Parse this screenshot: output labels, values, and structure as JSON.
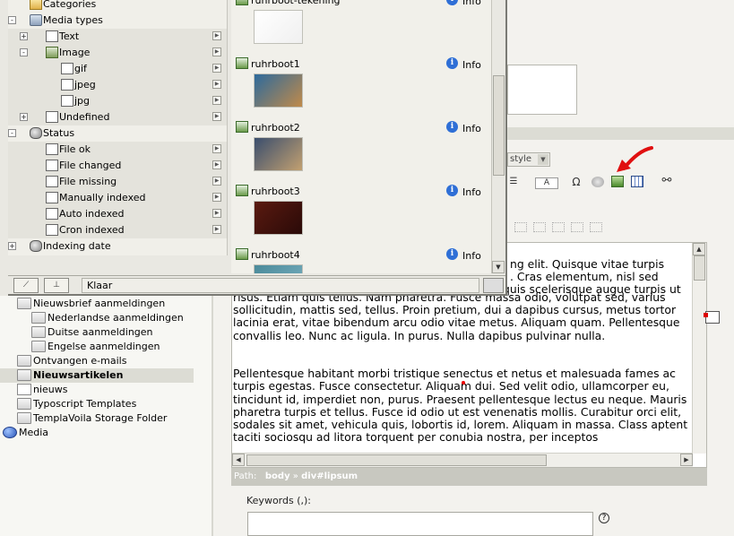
{
  "background_tree": {
    "items": [
      {
        "label": "Nieuwsbrief aanmeldingen",
        "indent": 0,
        "icon": "folder-icon"
      },
      {
        "label": "Nederlandse aanmeldingen",
        "indent": 1,
        "icon": "folder-icon"
      },
      {
        "label": "Duitse aanmeldingen",
        "indent": 1,
        "icon": "folder-icon"
      },
      {
        "label": "Engelse aanmeldingen",
        "indent": 1,
        "icon": "folder-icon"
      },
      {
        "label": "Ontvangen e-mails",
        "indent": 0,
        "icon": "folder-icon"
      },
      {
        "label": "Nieuwsartikelen",
        "indent": 0,
        "icon": "folder-icon",
        "selected": true
      },
      {
        "label": "nieuws",
        "indent": 0,
        "icon": "page-icon"
      },
      {
        "label": "Typoscript Templates",
        "indent": 0,
        "icon": "folder-icon"
      },
      {
        "label": "TemplaVoila Storage Folder",
        "indent": 0,
        "icon": "folder-icon"
      },
      {
        "label": "Media",
        "indent": -1,
        "icon": "globe-icon"
      }
    ]
  },
  "editor": {
    "style_select": "style",
    "text_partial_lines": [
      "ng elit. Quisque vitae turpis",
      ". Cras elementum, nisl sed",
      "quis scelerisque augue turpis ut"
    ],
    "paragraphs": [
      "risus. Etiam quis tellus. Nam pharetra. Fusce massa odio, volutpat sed, varius sollicitudin, mattis sed, tellus. Proin pretium, dui a dapibus cursus, metus tortor lacinia erat, vitae bibendum arcu odio vitae metus. Aliquam quam. Pellentesque convallis leo. Nunc ac ligula. In purus. Nulla dapibus pulvinar nulla.",
      "Pellentesque habitant morbi tristique senectus et netus et malesuada fames ac turpis egestas. Fusce consectetur. Aliquam dui. Sed velit odio, ullamcorper eu, tincidunt id, imperdiet non, purus. Praesent pellentesque lectus eu neque. Mauris pharetra turpis et tellus. Fusce id odio ut est venenatis mollis. Curabitur orci elit, sodales sit amet, vehicula quis, lobortis id, lorem. Aliquam in massa. Class aptent taciti sociosqu ad litora torquent per conubia nostra, per inceptos"
    ],
    "path_label": "Path:",
    "path_body": "body",
    "path_sep": "»",
    "path_div": "div#lipsum",
    "keywords_label": "Keywords (,):",
    "help": "?"
  },
  "popup": {
    "tree": [
      {
        "label": "Categories",
        "level": 1,
        "expander": "",
        "icon": "categories-icon"
      },
      {
        "label": "Media types",
        "level": 1,
        "expander": "−",
        "icon": "media-types-icon"
      },
      {
        "label": "Text",
        "level": 2,
        "expander": "+",
        "icon": "text-type-icon"
      },
      {
        "label": "Image",
        "level": 2,
        "expander": "−",
        "icon": "image-type-icon"
      },
      {
        "label": "gif",
        "level": 3,
        "expander": "",
        "icon": "doc-icon"
      },
      {
        "label": "jpeg",
        "level": 3,
        "expander": "",
        "icon": "doc-icon"
      },
      {
        "label": "jpg",
        "level": 3,
        "expander": "",
        "icon": "doc-icon"
      },
      {
        "label": "Undefined",
        "level": 2,
        "expander": "+",
        "icon": "doc-icon"
      },
      {
        "label": "Status",
        "level": 1,
        "expander": "−",
        "icon": "status-icon"
      },
      {
        "label": "File ok",
        "level": 2,
        "expander": "",
        "icon": "doc-icon"
      },
      {
        "label": "File changed",
        "level": 2,
        "expander": "",
        "icon": "doc-icon"
      },
      {
        "label": "File missing",
        "level": 2,
        "expander": "",
        "icon": "doc-icon"
      },
      {
        "label": "Manually indexed",
        "level": 2,
        "expander": "",
        "icon": "doc-icon"
      },
      {
        "label": "Auto indexed",
        "level": 2,
        "expander": "",
        "icon": "doc-icon"
      },
      {
        "label": "Cron indexed",
        "level": 2,
        "expander": "",
        "icon": "doc-icon"
      },
      {
        "label": "Indexing date",
        "level": 1,
        "expander": "+",
        "icon": "status-icon"
      }
    ],
    "files": [
      {
        "name": "ruhrboot-tekening",
        "info": "Info",
        "thumb_colors": [
          "#ffffff",
          "#f0f0f0"
        ]
      },
      {
        "name": "ruhrboot1",
        "info": "Info",
        "thumb_colors": [
          "#2d6a9c",
          "#c08a4a"
        ]
      },
      {
        "name": "ruhrboot2",
        "info": "Info",
        "thumb_colors": [
          "#3a4e6e",
          "#c2a070"
        ]
      },
      {
        "name": "ruhrboot3",
        "info": "Info",
        "thumb_colors": [
          "#5a1a10",
          "#2a0a08"
        ]
      },
      {
        "name": "ruhrboot4",
        "info": "Info",
        "thumb_colors": [
          "#4a8a9a",
          "#7ab0c0"
        ]
      }
    ],
    "status_text": "Klaar"
  },
  "colors": {
    "annotation_arrow": "#e01010",
    "info_icon": "#2f6fd6"
  }
}
